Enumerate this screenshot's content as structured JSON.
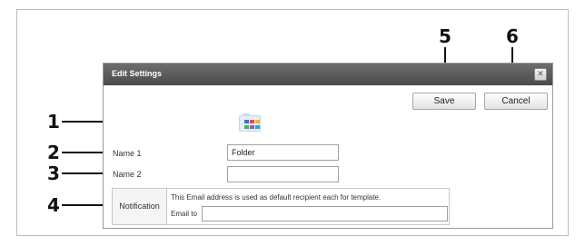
{
  "callouts": [
    "1",
    "2",
    "3",
    "4",
    "5",
    "6"
  ],
  "dialog": {
    "title": "Edit Settings",
    "close_glyph": "✕",
    "save_label": "Save",
    "cancel_label": "Cancel",
    "icon": "folder-grid-icon"
  },
  "fields": {
    "name1_label": "Name 1",
    "name1_value": "Folder",
    "name2_label": "Name 2",
    "name2_value": ""
  },
  "notification": {
    "label": "Notification",
    "description": "This Email address is used as default recipient each for template.",
    "email_label": "Email to",
    "email_value": ""
  },
  "colors": {
    "titlebar": "#555555",
    "callout": "#111111"
  }
}
